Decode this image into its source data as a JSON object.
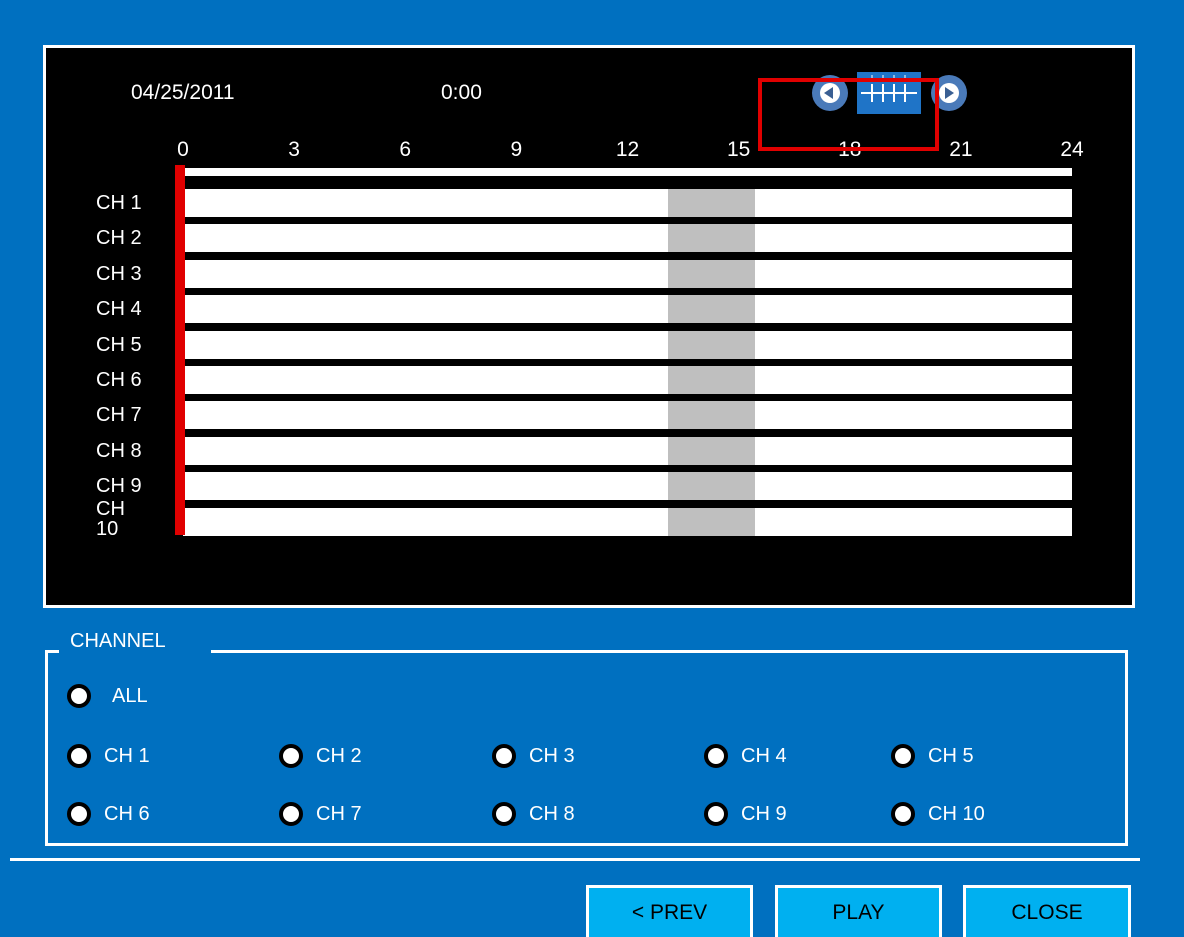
{
  "timeline": {
    "date": "04/25/2011",
    "time": "0:00",
    "hour_ticks": [
      "0",
      "3",
      "6",
      "9",
      "12",
      "15",
      "18",
      "21",
      "24"
    ],
    "cursor_hour": 0,
    "channels": [
      {
        "label": "CH 1"
      },
      {
        "label": "CH 2"
      },
      {
        "label": "CH 3"
      },
      {
        "label": "CH 4"
      },
      {
        "label": "CH 5"
      },
      {
        "label": "CH 6"
      },
      {
        "label": "CH 7"
      },
      {
        "label": "CH 8"
      },
      {
        "label": "CH 9"
      },
      {
        "label": "CH 10"
      }
    ],
    "recorded_range": {
      "start_hour": 13.1,
      "end_hour": 15.45
    },
    "colors": {
      "cursor": "#e00000",
      "recorded": "#bfbfbf",
      "highlight": "#e00000"
    },
    "zoom": {
      "prev_icon": "arrow-left-icon",
      "next_icon": "arrow-right-icon",
      "scale_icon": "timeline-scale-icon"
    }
  },
  "channel_group": {
    "legend": "CHANNEL",
    "all_label": "ALL",
    "options_row1": [
      "CH 1",
      "CH 2",
      "CH 3",
      "CH 4",
      "CH 5"
    ],
    "options_row2": [
      "CH 6",
      "CH 7",
      "CH 8",
      "CH 9",
      "CH 10"
    ]
  },
  "buttons": {
    "prev": "< PREV",
    "play": "PLAY",
    "close": "CLOSE"
  }
}
